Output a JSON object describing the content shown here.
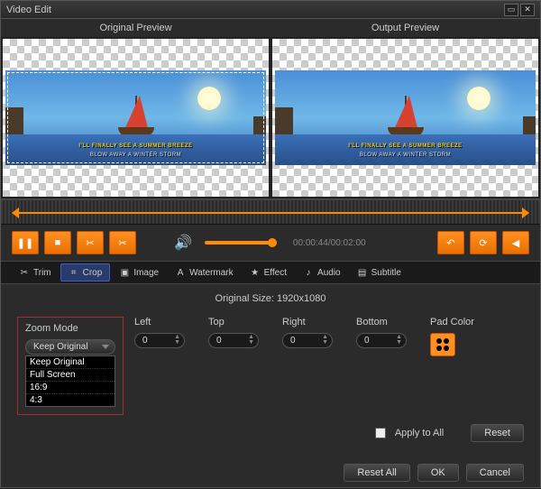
{
  "title": "Video Edit",
  "previews": {
    "original": "Original Preview",
    "output": "Output Preview"
  },
  "captions": {
    "line1": "I'LL FINALLY SEE A SUMMER BREEZE",
    "line2": "BLOW AWAY A WINTER STORM"
  },
  "playback": {
    "time_current": "00:00:44",
    "time_total": "00:02:00"
  },
  "tabs": {
    "trim": "Trim",
    "crop": "Crop",
    "image": "Image",
    "watermark": "Watermark",
    "effect": "Effect",
    "audio": "Audio",
    "subtitle": "Subtitle"
  },
  "crop": {
    "orig_size_label": "Original Size: 1920x1080",
    "zoom_mode_label": "Zoom Mode",
    "zoom_selected": "Keep Original",
    "zoom_options": [
      "Keep Original",
      "Full Screen",
      "16:9",
      "4:3"
    ],
    "left_label": "Left",
    "top_label": "Top",
    "right_label": "Right",
    "bottom_label": "Bottom",
    "left": "0",
    "top": "0",
    "right": "0",
    "bottom": "0",
    "padcolor_label": "Pad Color",
    "apply_all": "Apply to All",
    "reset": "Reset"
  },
  "buttons": {
    "reset_all": "Reset All",
    "ok": "OK",
    "cancel": "Cancel"
  }
}
